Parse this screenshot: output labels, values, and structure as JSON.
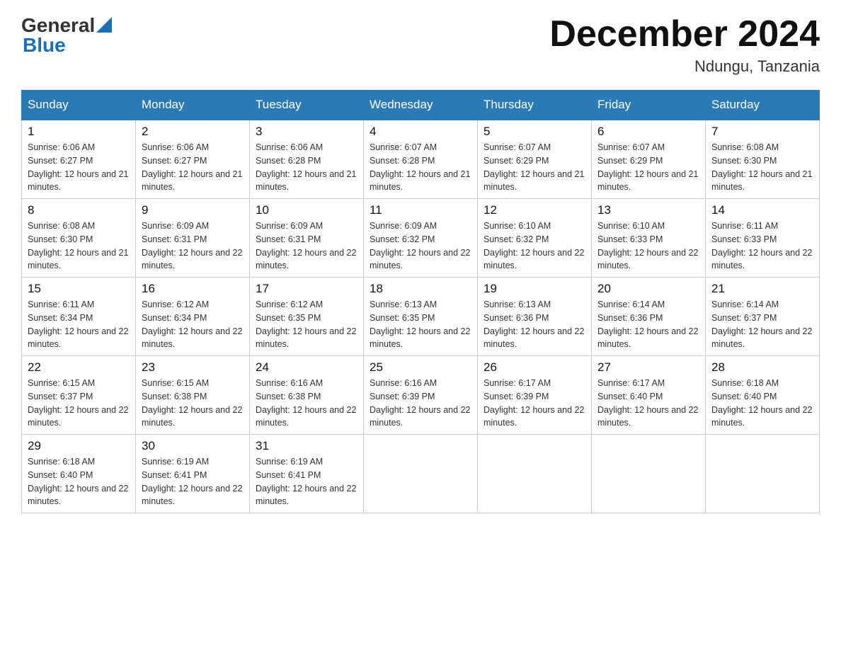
{
  "logo": {
    "general": "General",
    "blue": "Blue"
  },
  "header": {
    "title": "December 2024",
    "location": "Ndungu, Tanzania"
  },
  "days_of_week": [
    "Sunday",
    "Monday",
    "Tuesday",
    "Wednesday",
    "Thursday",
    "Friday",
    "Saturday"
  ],
  "weeks": [
    [
      {
        "day": "1",
        "sunrise": "6:06 AM",
        "sunset": "6:27 PM",
        "daylight": "12 hours and 21 minutes."
      },
      {
        "day": "2",
        "sunrise": "6:06 AM",
        "sunset": "6:27 PM",
        "daylight": "12 hours and 21 minutes."
      },
      {
        "day": "3",
        "sunrise": "6:06 AM",
        "sunset": "6:28 PM",
        "daylight": "12 hours and 21 minutes."
      },
      {
        "day": "4",
        "sunrise": "6:07 AM",
        "sunset": "6:28 PM",
        "daylight": "12 hours and 21 minutes."
      },
      {
        "day": "5",
        "sunrise": "6:07 AM",
        "sunset": "6:29 PM",
        "daylight": "12 hours and 21 minutes."
      },
      {
        "day": "6",
        "sunrise": "6:07 AM",
        "sunset": "6:29 PM",
        "daylight": "12 hours and 21 minutes."
      },
      {
        "day": "7",
        "sunrise": "6:08 AM",
        "sunset": "6:30 PM",
        "daylight": "12 hours and 21 minutes."
      }
    ],
    [
      {
        "day": "8",
        "sunrise": "6:08 AM",
        "sunset": "6:30 PM",
        "daylight": "12 hours and 21 minutes."
      },
      {
        "day": "9",
        "sunrise": "6:09 AM",
        "sunset": "6:31 PM",
        "daylight": "12 hours and 22 minutes."
      },
      {
        "day": "10",
        "sunrise": "6:09 AM",
        "sunset": "6:31 PM",
        "daylight": "12 hours and 22 minutes."
      },
      {
        "day": "11",
        "sunrise": "6:09 AM",
        "sunset": "6:32 PM",
        "daylight": "12 hours and 22 minutes."
      },
      {
        "day": "12",
        "sunrise": "6:10 AM",
        "sunset": "6:32 PM",
        "daylight": "12 hours and 22 minutes."
      },
      {
        "day": "13",
        "sunrise": "6:10 AM",
        "sunset": "6:33 PM",
        "daylight": "12 hours and 22 minutes."
      },
      {
        "day": "14",
        "sunrise": "6:11 AM",
        "sunset": "6:33 PM",
        "daylight": "12 hours and 22 minutes."
      }
    ],
    [
      {
        "day": "15",
        "sunrise": "6:11 AM",
        "sunset": "6:34 PM",
        "daylight": "12 hours and 22 minutes."
      },
      {
        "day": "16",
        "sunrise": "6:12 AM",
        "sunset": "6:34 PM",
        "daylight": "12 hours and 22 minutes."
      },
      {
        "day": "17",
        "sunrise": "6:12 AM",
        "sunset": "6:35 PM",
        "daylight": "12 hours and 22 minutes."
      },
      {
        "day": "18",
        "sunrise": "6:13 AM",
        "sunset": "6:35 PM",
        "daylight": "12 hours and 22 minutes."
      },
      {
        "day": "19",
        "sunrise": "6:13 AM",
        "sunset": "6:36 PM",
        "daylight": "12 hours and 22 minutes."
      },
      {
        "day": "20",
        "sunrise": "6:14 AM",
        "sunset": "6:36 PM",
        "daylight": "12 hours and 22 minutes."
      },
      {
        "day": "21",
        "sunrise": "6:14 AM",
        "sunset": "6:37 PM",
        "daylight": "12 hours and 22 minutes."
      }
    ],
    [
      {
        "day": "22",
        "sunrise": "6:15 AM",
        "sunset": "6:37 PM",
        "daylight": "12 hours and 22 minutes."
      },
      {
        "day": "23",
        "sunrise": "6:15 AM",
        "sunset": "6:38 PM",
        "daylight": "12 hours and 22 minutes."
      },
      {
        "day": "24",
        "sunrise": "6:16 AM",
        "sunset": "6:38 PM",
        "daylight": "12 hours and 22 minutes."
      },
      {
        "day": "25",
        "sunrise": "6:16 AM",
        "sunset": "6:39 PM",
        "daylight": "12 hours and 22 minutes."
      },
      {
        "day": "26",
        "sunrise": "6:17 AM",
        "sunset": "6:39 PM",
        "daylight": "12 hours and 22 minutes."
      },
      {
        "day": "27",
        "sunrise": "6:17 AM",
        "sunset": "6:40 PM",
        "daylight": "12 hours and 22 minutes."
      },
      {
        "day": "28",
        "sunrise": "6:18 AM",
        "sunset": "6:40 PM",
        "daylight": "12 hours and 22 minutes."
      }
    ],
    [
      {
        "day": "29",
        "sunrise": "6:18 AM",
        "sunset": "6:40 PM",
        "daylight": "12 hours and 22 minutes."
      },
      {
        "day": "30",
        "sunrise": "6:19 AM",
        "sunset": "6:41 PM",
        "daylight": "12 hours and 22 minutes."
      },
      {
        "day": "31",
        "sunrise": "6:19 AM",
        "sunset": "6:41 PM",
        "daylight": "12 hours and 22 minutes."
      },
      null,
      null,
      null,
      null
    ]
  ]
}
